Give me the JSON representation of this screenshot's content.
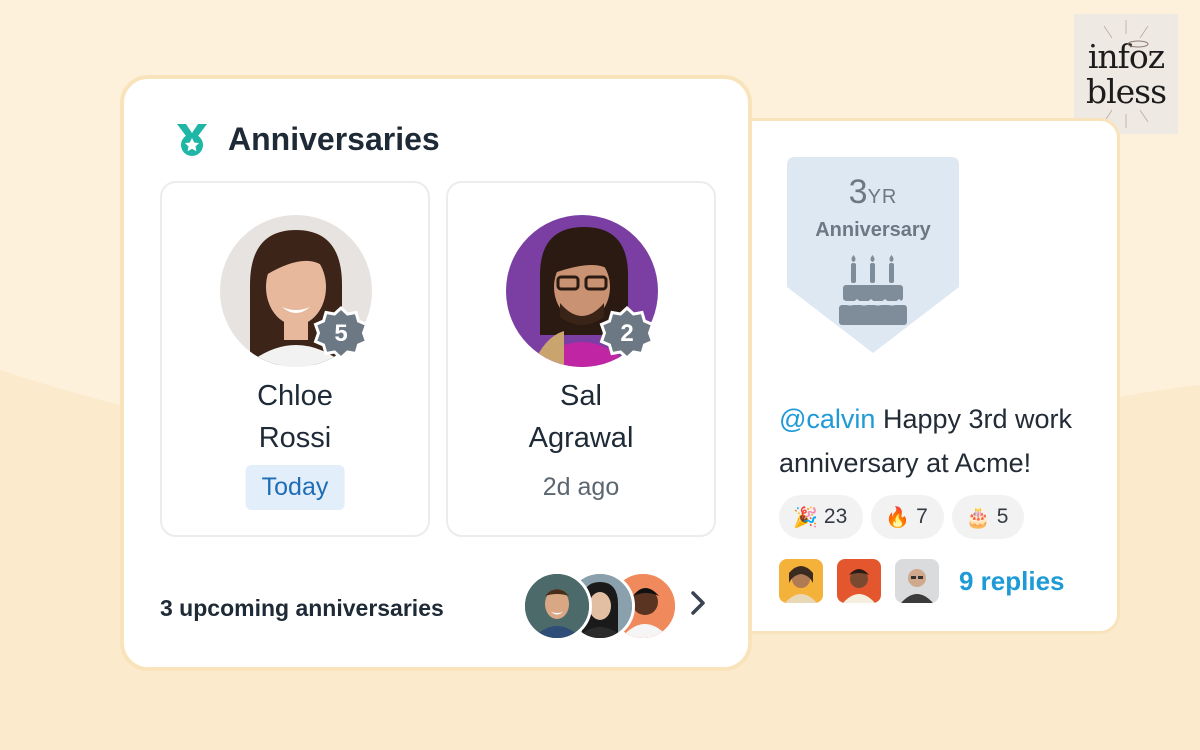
{
  "anniversaries_card": {
    "title": "Anniversaries",
    "people": [
      {
        "first_name": "Chloe",
        "last_name": "Rossi",
        "years": "5",
        "status": "Today"
      },
      {
        "first_name": "Sal",
        "last_name": "Agrawal",
        "years": "2",
        "status": "2d ago"
      }
    ],
    "upcoming_label": "3 upcoming anniversaries"
  },
  "post_card": {
    "badge": {
      "number": "3",
      "unit": "YR",
      "label": "Anniversary"
    },
    "mention": "@calvin",
    "message": " Happy 3rd work anniversary at Acme!",
    "reactions": [
      {
        "emoji": "🎉",
        "count": "23"
      },
      {
        "emoji": "🔥",
        "count": "7"
      },
      {
        "emoji": "🎂",
        "count": "5"
      }
    ],
    "replies_label": "9 replies"
  },
  "watermark": {
    "line1": "infoz",
    "line2": "bless"
  },
  "colors": {
    "background": "#fdf1dc",
    "card_border": "#f8e3bb",
    "accent_teal": "#1fb6a6",
    "link_blue": "#1e9ad6",
    "today_pill_bg": "#e3eefb",
    "badge_gray": "#6c7884"
  }
}
